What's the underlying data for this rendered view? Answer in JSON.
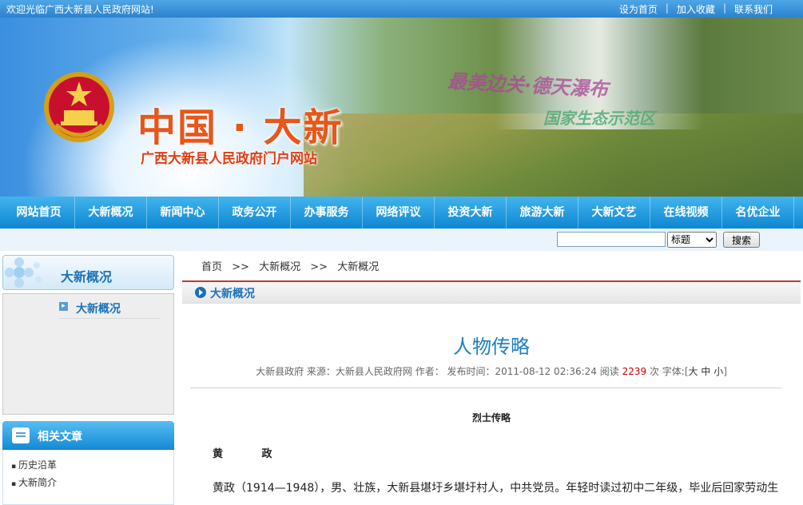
{
  "topbar": {
    "welcome": "欢迎光临广西大新县人民政府网站!",
    "links": [
      "设为首页",
      "加入收藏",
      "联系我们"
    ]
  },
  "banner": {
    "title": "中国 · 大新",
    "subtitle": "广西大新县人民政府门户网站",
    "slogan": "最美边关·德天瀑布",
    "slogan2": "国家生态示范区"
  },
  "nav": [
    "网站首页",
    "大新概况",
    "新闻中心",
    "政务公开",
    "办事服务",
    "网络评议",
    "投资大新",
    "旅游大新",
    "大新文艺",
    "在线视频",
    "名优企业"
  ],
  "search": {
    "placeholder": "",
    "select_value": "标题",
    "button": "搜索"
  },
  "sidebar": {
    "header": "大新概况",
    "sub_item": "大新概况",
    "related_header": "相关文章",
    "related": [
      "历史沿革",
      "大新简介"
    ]
  },
  "breadcrumb": [
    "首页",
    "大新概况",
    "大新概况"
  ],
  "breadcrumb_sep": ">>",
  "section_title": "大新概况",
  "article": {
    "title": "人物传略",
    "meta_prefix": "大新县政府 来源：大新县人民政府网 作者： 发布时间：2011-08-12 02:36:24 阅读",
    "read_count": "2239",
    "meta_suffix": "次 字体:[",
    "font_sizes": [
      "大",
      "中",
      "小"
    ],
    "meta_close": "]",
    "subheading": "烈士传略",
    "person_name": "黄 政",
    "paragraph": "黄政（1914—1948），男、壮族，大新县堪圩乡堪圩村人，中共党员。年轻时读过初中二年级，毕业后回家劳动生"
  },
  "colors": {
    "topbar": "#2b83cf",
    "nav": "#0d86d2",
    "title_orange": "#e8561a",
    "link_blue": "#1b72b8",
    "breadcrumb_line": "#c0392b"
  }
}
